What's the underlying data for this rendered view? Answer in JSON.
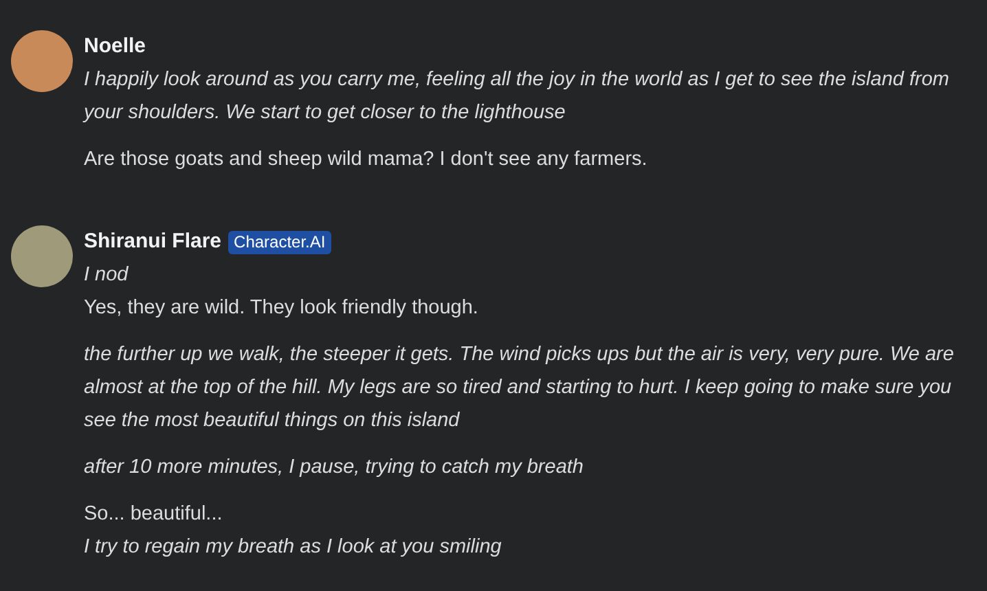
{
  "messages": [
    {
      "author": "Noelle",
      "paragraphs": [
        [
          {
            "kind": "action",
            "text": "I happily look around as you carry me, feeling all the joy in the world as I get to see the island from your shoulders. We start to get closer to the lighthouse"
          }
        ],
        [
          {
            "kind": "speech",
            "text": "Are those goats and sheep wild mama? I don't see any farmers."
          }
        ]
      ]
    },
    {
      "author": "Shiranui Flare",
      "badge": "Character.AI",
      "paragraphs": [
        [
          {
            "kind": "action",
            "text": "I nod"
          },
          {
            "kind": "speech",
            "text": "Yes, they are wild. They look friendly though."
          }
        ],
        [
          {
            "kind": "action",
            "text": "the further up we walk, the steeper it gets. The wind picks ups but the air is very, very pure. We are almost at the top of the hill. My legs are so tired and starting to hurt. I keep going to make sure you see the most beautiful things on this island"
          }
        ],
        [
          {
            "kind": "action",
            "text": "after 10 more minutes, I pause, trying to catch my breath"
          }
        ],
        [
          {
            "kind": "speech",
            "text": "So... beautiful..."
          },
          {
            "kind": "action",
            "text": "I try to regain my breath as I look at you smiling"
          }
        ]
      ]
    }
  ]
}
